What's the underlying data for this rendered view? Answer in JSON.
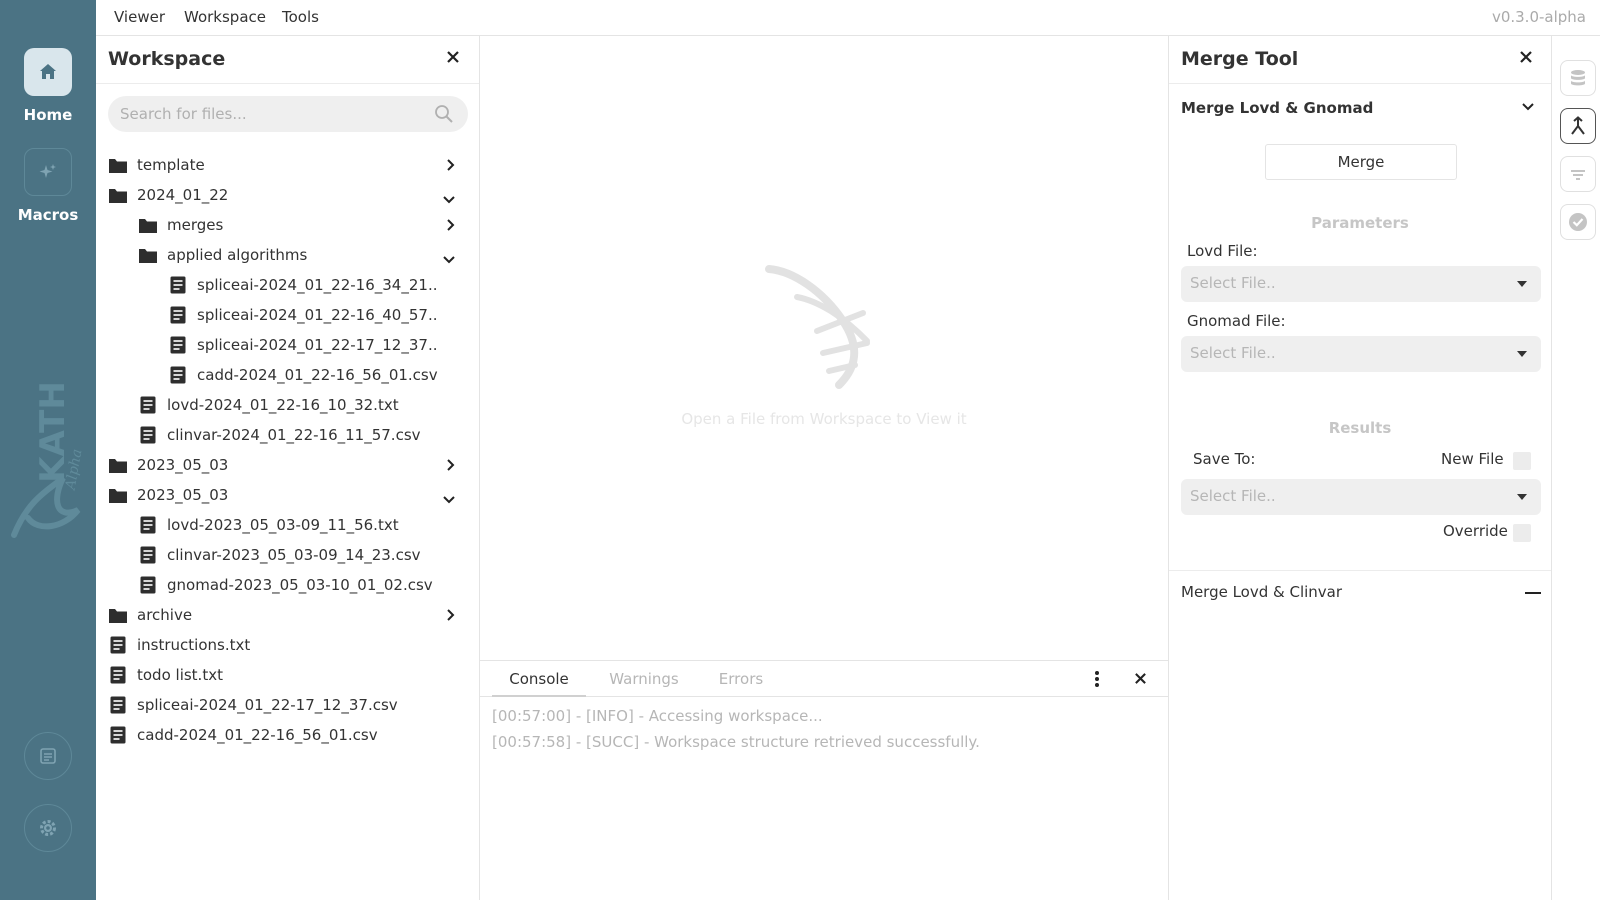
{
  "nav": {
    "home_label": "Home",
    "macros_label": "Macros",
    "brand_text": "KATH",
    "brand_sub": "Alpha"
  },
  "menu": {
    "items": [
      "Viewer",
      "Workspace",
      "Tools"
    ],
    "version": "v0.3.0-alpha"
  },
  "workspace": {
    "title": "Workspace",
    "search_placeholder": "Search for files...",
    "tree": [
      {
        "label": "template",
        "type": "folder",
        "depth": 0,
        "chevron": "right"
      },
      {
        "label": "2024_01_22",
        "type": "folder",
        "depth": 0,
        "chevron": "down"
      },
      {
        "label": "merges",
        "type": "folder",
        "depth": 1,
        "chevron": "right"
      },
      {
        "label": "applied algorithms",
        "type": "folder",
        "depth": 1,
        "chevron": "down"
      },
      {
        "label": "spliceai-2024_01_22-16_34_21..",
        "type": "file",
        "depth": 2,
        "chevron": ""
      },
      {
        "label": "spliceai-2024_01_22-16_40_57..",
        "type": "file",
        "depth": 2,
        "chevron": ""
      },
      {
        "label": "spliceai-2024_01_22-17_12_37..",
        "type": "file",
        "depth": 2,
        "chevron": ""
      },
      {
        "label": "cadd-2024_01_22-16_56_01.csv",
        "type": "file",
        "depth": 2,
        "chevron": ""
      },
      {
        "label": "lovd-2024_01_22-16_10_32.txt",
        "type": "file",
        "depth": 1,
        "chevron": ""
      },
      {
        "label": "clinvar-2024_01_22-16_11_57.csv",
        "type": "file",
        "depth": 1,
        "chevron": ""
      },
      {
        "label": "2023_05_03",
        "type": "folder",
        "depth": 0,
        "chevron": "right"
      },
      {
        "label": "2023_05_03",
        "type": "folder",
        "depth": 0,
        "chevron": "down"
      },
      {
        "label": "lovd-2023_05_03-09_11_56.txt",
        "type": "file",
        "depth": 1,
        "chevron": ""
      },
      {
        "label": "clinvar-2023_05_03-09_14_23.csv",
        "type": "file",
        "depth": 1,
        "chevron": ""
      },
      {
        "label": "gnomad-2023_05_03-10_01_02.csv",
        "type": "file",
        "depth": 1,
        "chevron": ""
      },
      {
        "label": "archive",
        "type": "folder",
        "depth": 0,
        "chevron": "right"
      },
      {
        "label": "instructions.txt",
        "type": "file",
        "depth": 0,
        "chevron": ""
      },
      {
        "label": "todo list.txt",
        "type": "file",
        "depth": 0,
        "chevron": ""
      },
      {
        "label": "spliceai-2024_01_22-17_12_37.csv",
        "type": "file",
        "depth": 0,
        "chevron": ""
      },
      {
        "label": "cadd-2024_01_22-16_56_01.csv",
        "type": "file",
        "depth": 0,
        "chevron": ""
      }
    ]
  },
  "viewer": {
    "hint": "Open a File from Workspace to View it"
  },
  "console": {
    "tabs": [
      "Console",
      "Warnings",
      "Errors"
    ],
    "active_tab": "Console",
    "logs": [
      "[00:57:00] - [INFO] - Accessing workspace...",
      "[00:57:58] - [SUCC] - Workspace structure retrieved successfully."
    ]
  },
  "merge_tool": {
    "title": "Merge Tool",
    "section1_title": "Merge Lovd & Gnomad",
    "merge_button": "Merge",
    "parameters_label": "Parameters",
    "lovd_file_label": "Lovd File:",
    "lovd_file_placeholder": "Select File..",
    "gnomad_file_label": "Gnomad File:",
    "gnomad_file_placeholder": "Select File..",
    "results_label": "Results",
    "save_to_label": "Save To:",
    "new_file_label": "New File",
    "save_to_placeholder": "Select File..",
    "override_label": "Override",
    "section2_title": "Merge Lovd & Clinvar"
  },
  "colors": {
    "nav_bg": "#4b7384",
    "nav_active": "#d9e6ec",
    "muted_text": "#b6b6b6"
  }
}
